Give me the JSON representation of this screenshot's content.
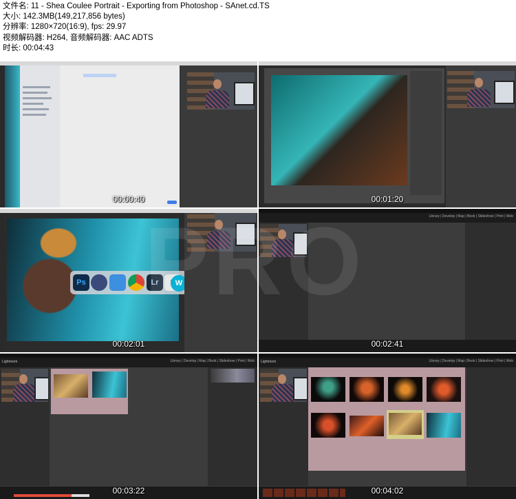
{
  "file_info": {
    "filename": "文件名: 11 - Shea Coulee Portrait - Exporting from Photoshop - SAnet.cd.TS",
    "size": "大小: 142.3MB(149,217,856 bytes)",
    "resolution": "分辨率: 1280×720(16:9), fps: 29.97",
    "codecs": "视频解码器: H264, 音频解码器: AAC ADTS",
    "duration": "时长: 00:04:43"
  },
  "frames": [
    {
      "timestamp": "00:00:40",
      "app": "Photoshop",
      "view": "save-dialog"
    },
    {
      "timestamp": "00:01:20",
      "app": "Photoshop",
      "view": "export-dialog"
    },
    {
      "timestamp": "00:02:01",
      "app": "Photoshop",
      "view": "dock"
    },
    {
      "timestamp": "00:02:41",
      "app": "Lightroom",
      "view": "empty-library"
    },
    {
      "timestamp": "00:03:22",
      "app": "Lightroom",
      "view": "library-two-photos"
    },
    {
      "timestamp": "00:04:02",
      "app": "Lightroom",
      "view": "library-grid"
    }
  ],
  "dock": {
    "ps_label": "Ps",
    "lr_label": "Lr",
    "s_label": "S",
    "w_label": "W"
  },
  "lightroom": {
    "logo": "Lightroom",
    "modules": "Library | Develop | Map | Book | Slideshow | Print | Web"
  },
  "watermark": "PRO"
}
